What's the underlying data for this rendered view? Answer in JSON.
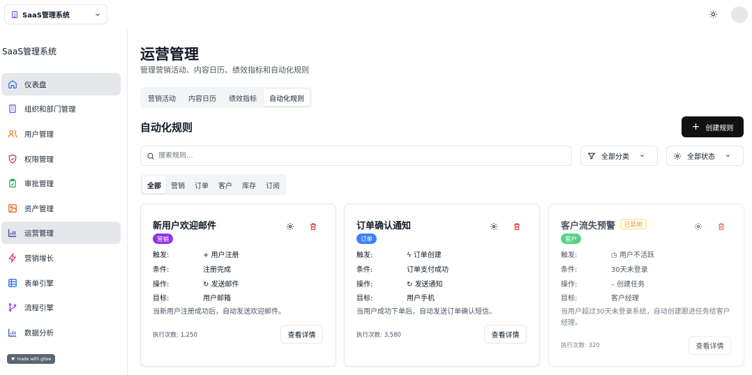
{
  "topbar": {
    "org_name": "SaaS管理系统"
  },
  "sidebar": {
    "brand": "SaaS管理系统",
    "items": [
      {
        "label": "仪表盘",
        "icon": "home-icon"
      },
      {
        "label": "组织和部门管理",
        "icon": "building-icon"
      },
      {
        "label": "用户管理",
        "icon": "users-icon"
      },
      {
        "label": "权限管理",
        "icon": "shield-icon"
      },
      {
        "label": "审批管理",
        "icon": "clipboard-check-icon"
      },
      {
        "label": "资产管理",
        "icon": "image-icon"
      },
      {
        "label": "运营管理",
        "icon": "bar-chart-icon"
      },
      {
        "label": "营销增长",
        "icon": "zap-icon"
      },
      {
        "label": "表单引擎",
        "icon": "table-icon"
      },
      {
        "label": "流程引擎",
        "icon": "git-branch-icon"
      },
      {
        "label": "数据分析",
        "icon": "chart-icon"
      }
    ],
    "active_index": 6
  },
  "main": {
    "title": "运营管理",
    "subtitle": "管理营销活动、内容日历、绩效指标和自动化规则",
    "tabs": [
      "营销活动",
      "内容日历",
      "绩效指标",
      "自动化规则"
    ],
    "active_tab": 3,
    "section_title": "自动化规则",
    "create_label": "创建规则",
    "search_placeholder": "搜索规则...",
    "filter_category": "全部分类",
    "filter_status": "全部状态",
    "category_tabs": [
      "全部",
      "营销",
      "订单",
      "客户",
      "库存",
      "订阅"
    ],
    "active_category": 0
  },
  "cards": [
    {
      "name": "新用户欢迎邮件",
      "badge": "营销",
      "badge_color": "#9333ea",
      "trigger_label": "触发:",
      "trigger": "+ 用户注册",
      "condition_label": "条件:",
      "condition": "注册完成",
      "action_label": "操作:",
      "action": "发送邮件",
      "target_label": "目标:",
      "target": "用户邮箱",
      "description": "当新用户注册成功后，自动发送欢迎邮件。",
      "exec": "执行次数: 1,250",
      "detail": "查看详情"
    },
    {
      "name": "订单确认通知",
      "badge": "订单",
      "badge_color": "#3b82f6",
      "trigger_label": "触发:",
      "trigger": "ϟ 订单创建",
      "condition_label": "条件:",
      "condition": "订单支付成功",
      "action_label": "操作:",
      "action": "发送通知",
      "target_label": "目标:",
      "target": "用户手机",
      "description": "当用户成功下单后，自动发送订单确认短信。",
      "exec": "执行次数: 3,580",
      "detail": "查看详情"
    },
    {
      "name": "客户流失预警",
      "status": "已禁用",
      "badge": "客户",
      "badge_color": "#22c55e",
      "trigger_label": "触发:",
      "trigger": "用户不活跃",
      "condition_label": "条件:",
      "condition": "30天未登录",
      "action_label": "操作:",
      "action": "– 创建任务",
      "target_label": "目标:",
      "target": "客户经理",
      "description": "当用户超过30天未登录系统，自动创建跟进任务给客户经理。",
      "exec": "执行次数: 320",
      "detail": "查看详情"
    }
  ],
  "watermark": "made with gitee",
  "colors": {
    "primary": "#111111",
    "danger": "#dc2626",
    "active_nav": "#e5e7eb"
  }
}
